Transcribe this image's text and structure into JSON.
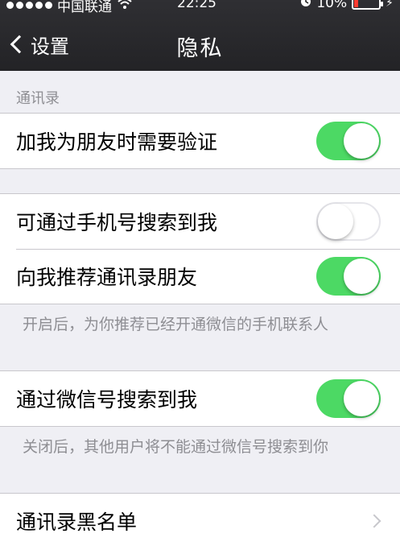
{
  "status_bar": {
    "carrier": "中国联通",
    "time": "22:25",
    "battery_percent": "10%",
    "battery_level": 0.1,
    "colors": {
      "battery_low": "#ff3b30"
    }
  },
  "nav": {
    "back_label": "设置",
    "title": "隐私"
  },
  "sections": {
    "contacts_header": "通讯录",
    "verify_label": "加我为朋友时需要验证",
    "verify_on": true,
    "phone_search_label": "可通过手机号搜索到我",
    "phone_search_on": false,
    "recommend_label": "向我推荐通讯录朋友",
    "recommend_on": true,
    "recommend_footer": "开启后，为你推荐已经开通微信的手机联系人",
    "wechat_id_label": "通过微信号搜索到我",
    "wechat_id_on": true,
    "wechat_id_footer": "关闭后，其他用户将不能通过微信号搜索到你",
    "blacklist_label": "通讯录黑名单"
  },
  "colors": {
    "toggle_on": "#4cd964",
    "nav_background": "#2a2a2d",
    "page_background": "#efeff4"
  },
  "icons": [
    "signal-dots-icon",
    "wifi-icon",
    "alarm-icon",
    "battery-icon",
    "charging-bolt-icon",
    "back-chevron-icon",
    "disclosure-chevron-icon"
  ]
}
